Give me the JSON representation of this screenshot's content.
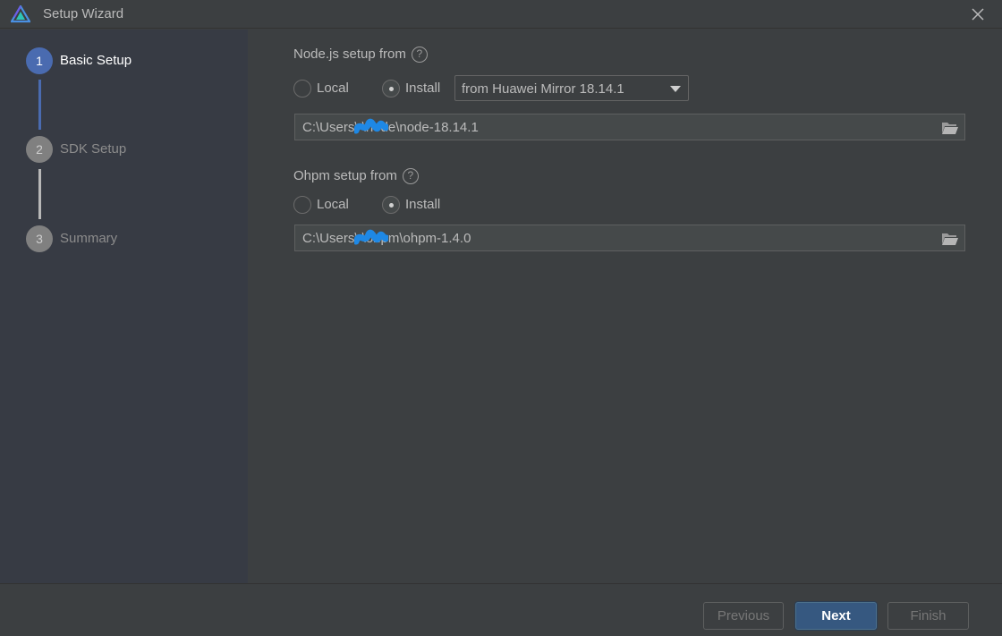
{
  "window": {
    "title": "Setup Wizard",
    "logo_icon": "harmonyos-devtools-logo-icon",
    "close_icon": "close-icon"
  },
  "steps": [
    {
      "number": "1",
      "label": "Basic Setup",
      "state": "active"
    },
    {
      "number": "2",
      "label": "SDK Setup",
      "state": "inactive"
    },
    {
      "number": "3",
      "label": "Summary",
      "state": "inactive"
    }
  ],
  "nodejs": {
    "label": "Node.js setup from",
    "help_icon": "?",
    "option_local": "Local",
    "option_install": "Install",
    "selected": "Install",
    "mirror_select": "from Huawei Mirror 18.14.1",
    "path": "C:\\Users\\        \\node\\node-18.14.1"
  },
  "ohpm": {
    "label": "Ohpm setup from",
    "help_icon": "?",
    "option_local": "Local",
    "option_install": "Install",
    "selected": "Install",
    "path": "C:\\Users\\        \\ohpm\\ohpm-1.4.0"
  },
  "footer": {
    "previous": "Previous",
    "next": "Next",
    "finish": "Finish"
  },
  "colors": {
    "accent": "#4a6bb0",
    "primary_button": "#365880",
    "redaction": "#1e88e5"
  }
}
